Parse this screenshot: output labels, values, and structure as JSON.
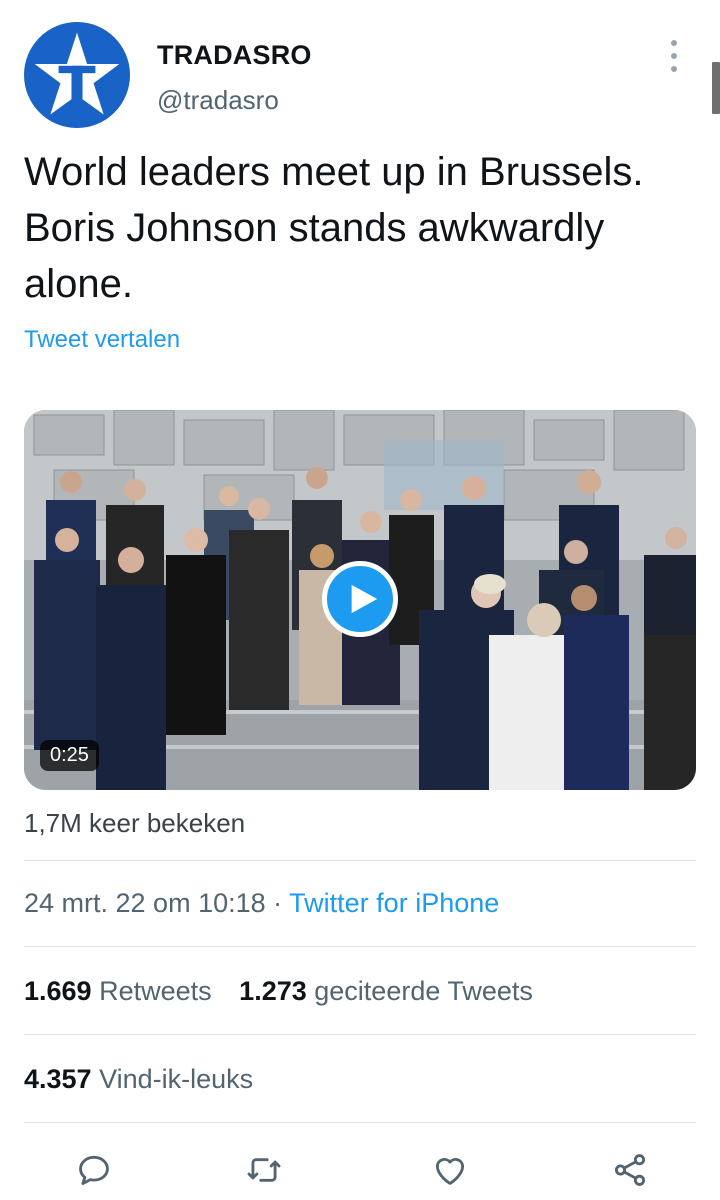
{
  "author": {
    "display_name": "TRADASRO",
    "handle": "@tradasro",
    "avatar_icon": "star-t-logo",
    "avatar_color": "#1a63c6"
  },
  "tweet": {
    "text": "World leaders meet up in Brussels. Boris Johnson stands awkwardly alone.",
    "translate_label": "Tweet vertalen"
  },
  "media": {
    "duration": "0:25",
    "play_icon": "play-icon",
    "views": "1,7M keer bekeken"
  },
  "meta": {
    "timestamp": "24 mrt. 22 om 10:18",
    "separator": "·",
    "source": "Twitter for iPhone"
  },
  "stats": {
    "retweets_count": "1.669",
    "retweets_label": "Retweets",
    "quotes_count": "1.273",
    "quotes_label": "geciteerde Tweets",
    "likes_count": "4.357",
    "likes_label": "Vind-ik-leuks"
  },
  "actions": [
    "reply-icon",
    "retweet-icon",
    "like-icon",
    "share-icon"
  ],
  "colors": {
    "accent": "#1d9bf0",
    "text": "#0f1419",
    "secondary": "#536471"
  }
}
